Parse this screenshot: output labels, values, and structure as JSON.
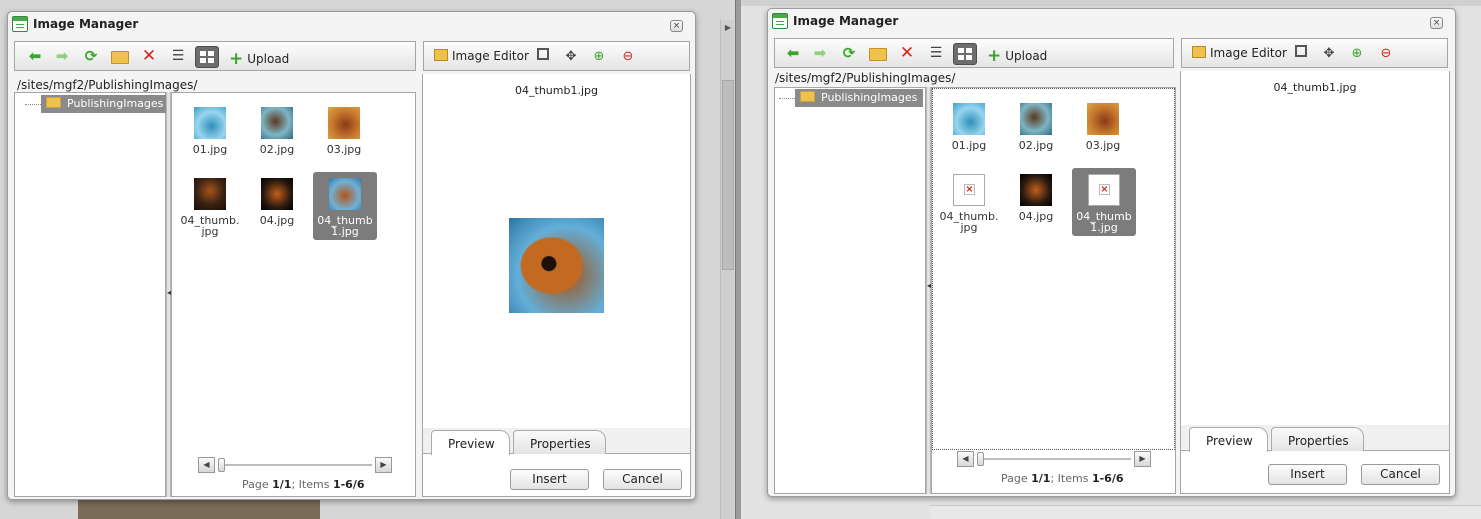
{
  "dialogs": [
    {
      "title": "Image Manager",
      "close_label": "×",
      "upload_label": "Upload",
      "image_editor_label": "Image Editor",
      "path": "/sites/mgf2/PublishingImages/",
      "tree_folder": "PublishingImages",
      "files": [
        {
          "name": "01.jpg",
          "thumbnail": "ok"
        },
        {
          "name": "02.jpg",
          "thumbnail": "ok"
        },
        {
          "name": "03.jpg",
          "thumbnail": "ok"
        },
        {
          "name": "04_thumb.jpg",
          "thumbnail": "ok"
        },
        {
          "name": "04.jpg",
          "thumbnail": "ok"
        },
        {
          "name": "04_thumb1.jpg",
          "thumbnail": "ok",
          "selected": true
        }
      ],
      "pager": {
        "page_label": "Page",
        "page": "1/1",
        "items_label": "Items",
        "items": "1-6/6"
      },
      "preview_filename": "04_thumb1.jpg",
      "preview_shown": true,
      "tabs": [
        "Preview",
        "Properties"
      ],
      "active_tab": "Preview",
      "insert_label": "Insert",
      "cancel_label": "Cancel"
    },
    {
      "title": "Image Manager",
      "close_label": "×",
      "upload_label": "Upload",
      "image_editor_label": "Image Editor",
      "path": "/sites/mgf2/PublishingImages/",
      "tree_folder": "PublishingImages",
      "files": [
        {
          "name": "01.jpg",
          "thumbnail": "ok"
        },
        {
          "name": "02.jpg",
          "thumbnail": "ok"
        },
        {
          "name": "03.jpg",
          "thumbnail": "ok"
        },
        {
          "name": "04_thumb.jpg",
          "thumbnail": "broken"
        },
        {
          "name": "04.jpg",
          "thumbnail": "ok"
        },
        {
          "name": "04_thumb1.jpg",
          "thumbnail": "broken",
          "selected": true
        }
      ],
      "pager": {
        "page_label": "Page",
        "page": "1/1",
        "items_label": "Items",
        "items": "1-6/6"
      },
      "preview_filename": "04_thumb1.jpg",
      "preview_shown": false,
      "tabs": [
        "Preview",
        "Properties"
      ],
      "active_tab": "Preview",
      "insert_label": "Insert",
      "cancel_label": "Cancel"
    }
  ],
  "icons": {
    "back": "arrow-left-icon",
    "forward": "arrow-right-icon",
    "refresh": "refresh-icon",
    "new_folder": "new-folder-icon",
    "delete": "delete-icon",
    "list_view": "list-view-icon",
    "thumb_view": "thumbnail-view-icon",
    "upload": "upload-plus-icon",
    "best_fit": "best-fit-icon",
    "actual_size": "actual-size-icon",
    "zoom_in": "zoom-in-icon",
    "zoom_out": "zoom-out-icon"
  },
  "colors": {
    "accent_green": "#3aa52c",
    "delete_red": "#d4261a",
    "selection_gray": "#7c7c7c"
  }
}
